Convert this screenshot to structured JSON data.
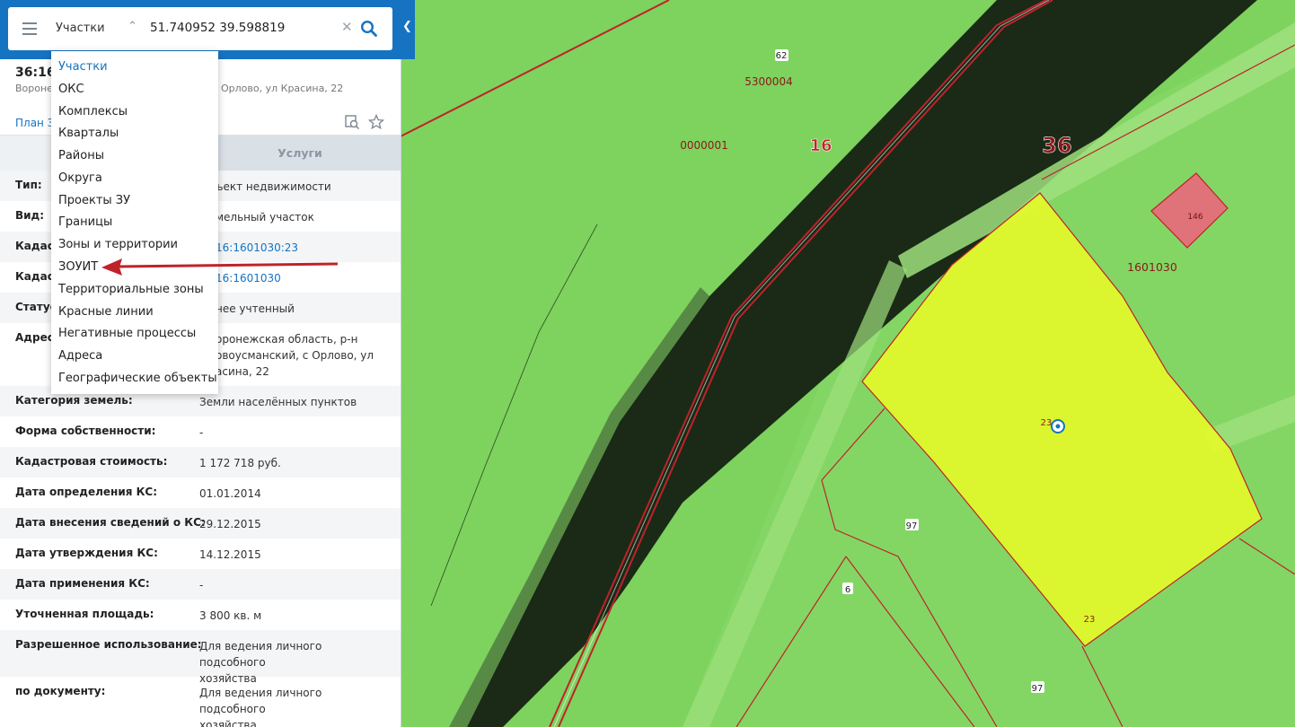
{
  "search": {
    "type_selected": "Участки",
    "value": "51.740952 39.598819"
  },
  "dropdown": {
    "items": [
      "Участки",
      "ОКС",
      "Комплексы",
      "Кварталы",
      "Районы",
      "Округа",
      "Проекты ЗУ",
      "Границы",
      "Зоны и территории",
      "ЗОУИТ",
      "Территориальные зоны",
      "Красные линии",
      "Негативные процессы",
      "Адреса",
      "Географические объекты"
    ],
    "selected": "Участки",
    "highlighted": "ЗОУИТ"
  },
  "object": {
    "title_visible": "36:16:",
    "address_left": "Воронеж",
    "address_right": "Орлово, ул Красина, 22",
    "plan_link": "План З",
    "services_tab": "Услуги"
  },
  "attributes": [
    {
      "label": "Тип:",
      "value": "ъект недвижимости"
    },
    {
      "label": "Вид:",
      "value": "мельный участок"
    },
    {
      "label": "Кадаст",
      "value": "16:1601030:23",
      "link": true
    },
    {
      "label": "Кадаст",
      "value": "16:1601030",
      "link": true
    },
    {
      "label": "Статус:",
      "value": "нее учтенный"
    },
    {
      "label": "Адрес:",
      "value": "оронежская область, р-н\nовоусманский, с Орлово, ул\nасина, 22"
    },
    {
      "label": "Категория земель:",
      "value": "Земли населённых пунктов"
    },
    {
      "label": "Форма собственности:",
      "value": "-"
    },
    {
      "label": "Кадастровая стоимость:",
      "value": "1 172 718 руб."
    },
    {
      "label": "Дата определения КС:",
      "value": "01.01.2014"
    },
    {
      "label": "Дата внесения сведений о КС:",
      "value": "29.12.2015"
    },
    {
      "label": "Дата утверждения КС:",
      "value": "14.12.2015"
    },
    {
      "label": "Дата применения КС:",
      "value": "-"
    },
    {
      "label": "Уточненная площадь:",
      "value": "3 800 кв. м"
    },
    {
      "label": "Разрешенное использование:",
      "value": "Для ведения личного подсобного\nхозяйства"
    },
    {
      "label": "по документу:",
      "value": "Для ведения личного подсобного\nхозяйства"
    }
  ],
  "map_labels": {
    "q62": "62",
    "q5300004": "5300004",
    "q0000001": "0000001",
    "district16": "16",
    "region36": "36",
    "q146": "146",
    "q1601030": "1601030",
    "p23a": "23",
    "p23b": "23",
    "p97a": "97",
    "p97b": "97",
    "p6": "6"
  },
  "colors": {
    "accent": "#1673c1",
    "parcel_fill": "#e3f82a",
    "boundary": "#c0222a",
    "arrow": "#c0222a"
  }
}
